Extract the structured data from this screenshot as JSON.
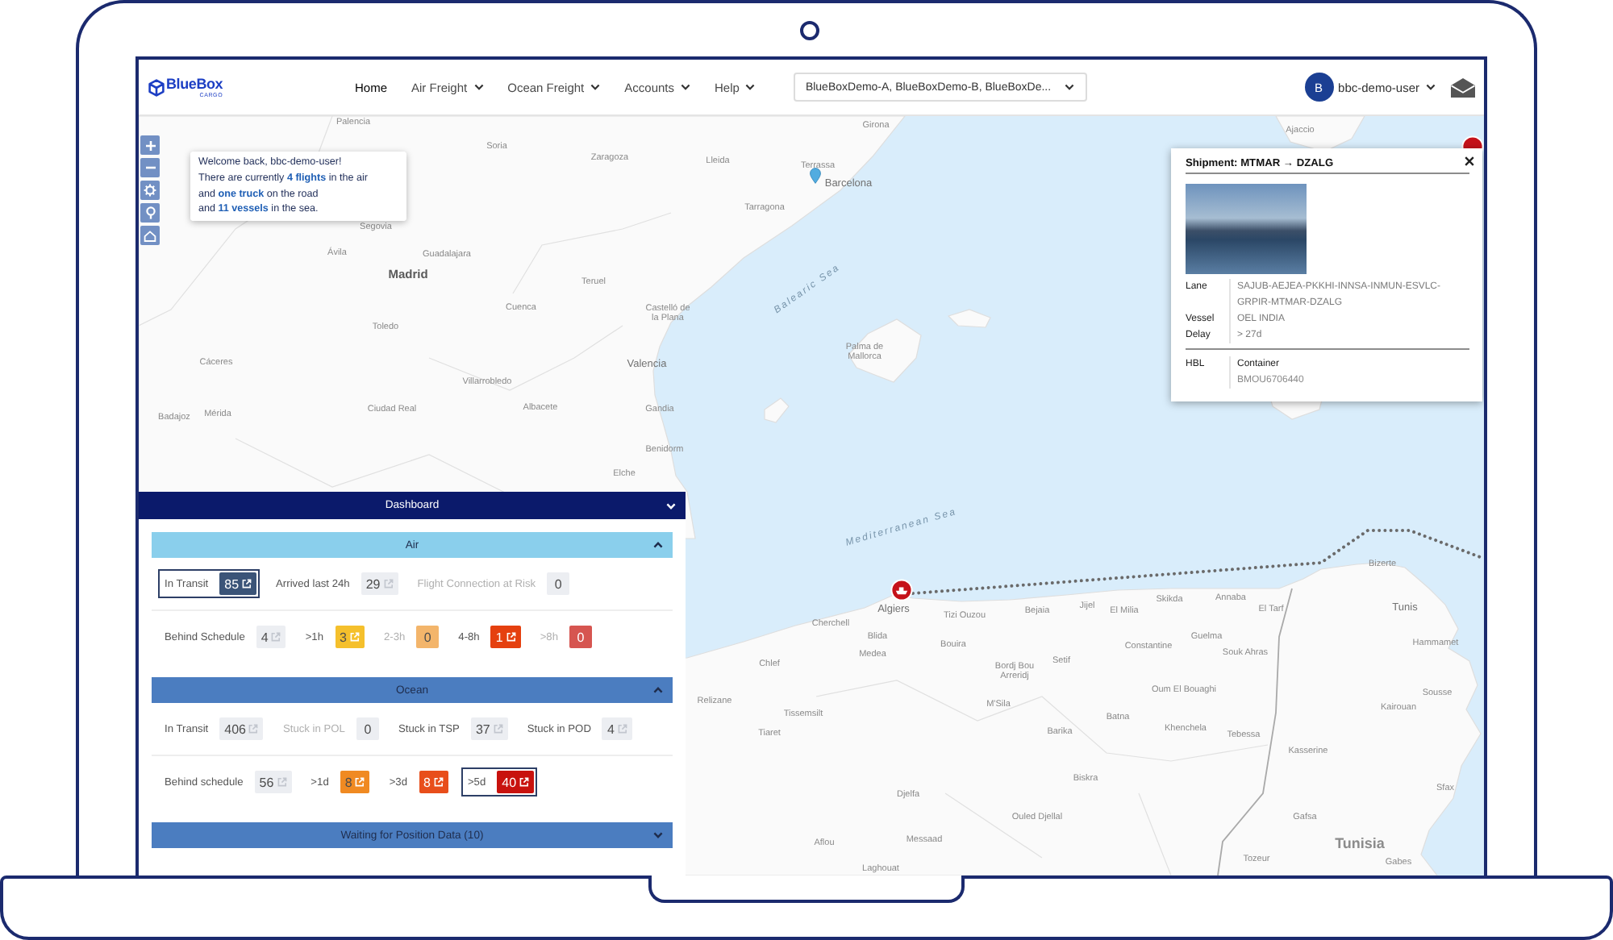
{
  "header": {
    "logo": {
      "name": "BlueBox",
      "tagline": "CARGO"
    },
    "nav": [
      {
        "label": "Home",
        "selected": true,
        "dropdown": false
      },
      {
        "label": "Air Freight",
        "selected": false,
        "dropdown": true
      },
      {
        "label": "Ocean Freight",
        "selected": false,
        "dropdown": true
      },
      {
        "label": "Accounts",
        "selected": false,
        "dropdown": true
      },
      {
        "label": "Help",
        "selected": false,
        "dropdown": true
      }
    ],
    "account_filter": {
      "value": "BlueBoxDemo-A, BlueBoxDemo-B, BlueBoxDe..."
    },
    "user": {
      "initial": "B",
      "name": "bbc-demo-user"
    }
  },
  "map": {
    "labels": [
      {
        "text": "Palencia",
        "kind": "city"
      },
      {
        "text": "Soria",
        "kind": "city"
      },
      {
        "text": "Zaragoza",
        "kind": "city"
      },
      {
        "text": "Segovia",
        "kind": "city"
      },
      {
        "text": "Ávila",
        "kind": "city"
      },
      {
        "text": "Guadalajara",
        "kind": "city"
      },
      {
        "text": "Madrid",
        "kind": "capital"
      },
      {
        "text": "Teruel",
        "kind": "city"
      },
      {
        "text": "Cuenca",
        "kind": "city"
      },
      {
        "text": "Castelló de la Plana",
        "kind": "city"
      },
      {
        "text": "Toledo",
        "kind": "city"
      },
      {
        "text": "Cáceres",
        "kind": "city"
      },
      {
        "text": "Valencia",
        "kind": "major"
      },
      {
        "text": "Villarrobledo",
        "kind": "city"
      },
      {
        "text": "Ciudad Real",
        "kind": "city"
      },
      {
        "text": "Albacete",
        "kind": "city"
      },
      {
        "text": "Gandia",
        "kind": "city"
      },
      {
        "text": "Mérida",
        "kind": "city"
      },
      {
        "text": "Badajoz",
        "kind": "city"
      },
      {
        "text": "Benidorm",
        "kind": "city"
      },
      {
        "text": "Elche",
        "kind": "city"
      },
      {
        "text": "Girona",
        "kind": "city"
      },
      {
        "text": "Lleida",
        "kind": "city"
      },
      {
        "text": "Terrassa",
        "kind": "city"
      },
      {
        "text": "Barcelona",
        "kind": "major"
      },
      {
        "text": "Tarragona",
        "kind": "city"
      },
      {
        "text": "Ajaccio",
        "kind": "city"
      },
      {
        "text": "Balearic Sea",
        "kind": "sea"
      },
      {
        "text": "Palma de Mallorca",
        "kind": "city"
      },
      {
        "text": "Mediterranean Sea",
        "kind": "sea"
      },
      {
        "text": "Algiers",
        "kind": "major"
      },
      {
        "text": "Tizi Ouzou",
        "kind": "city"
      },
      {
        "text": "Bejaia",
        "kind": "city"
      },
      {
        "text": "Jijel",
        "kind": "city"
      },
      {
        "text": "El Milia",
        "kind": "city"
      },
      {
        "text": "Skikda",
        "kind": "city"
      },
      {
        "text": "Annaba",
        "kind": "city"
      },
      {
        "text": "El Tarf",
        "kind": "city"
      },
      {
        "text": "Bizerte",
        "kind": "city"
      },
      {
        "text": "Tunis",
        "kind": "major"
      },
      {
        "text": "Cherchell",
        "kind": "city"
      },
      {
        "text": "Blida",
        "kind": "city"
      },
      {
        "text": "Medea",
        "kind": "city"
      },
      {
        "text": "Bouira",
        "kind": "city"
      },
      {
        "text": "Chlef",
        "kind": "city"
      },
      {
        "text": "Relizane",
        "kind": "city"
      },
      {
        "text": "Tissemsilt",
        "kind": "city"
      },
      {
        "text": "Tiaret",
        "kind": "city"
      },
      {
        "text": "Bordj Bou Arreridj",
        "kind": "city"
      },
      {
        "text": "Setif",
        "kind": "city"
      },
      {
        "text": "Constantine",
        "kind": "city"
      },
      {
        "text": "Guelma",
        "kind": "city"
      },
      {
        "text": "Souk Ahras",
        "kind": "city"
      },
      {
        "text": "Hammamet",
        "kind": "city"
      },
      {
        "text": "M'Sila",
        "kind": "city"
      },
      {
        "text": "Oum El Bouaghi",
        "kind": "city"
      },
      {
        "text": "Batna",
        "kind": "city"
      },
      {
        "text": "Barika",
        "kind": "city"
      },
      {
        "text": "Khenchela",
        "kind": "city"
      },
      {
        "text": "Tebessa",
        "kind": "city"
      },
      {
        "text": "Sousse",
        "kind": "city"
      },
      {
        "text": "Kairouan",
        "kind": "city"
      },
      {
        "text": "Kasserine",
        "kind": "city"
      },
      {
        "text": "Biskra",
        "kind": "city"
      },
      {
        "text": "Djelfa",
        "kind": "city"
      },
      {
        "text": "Sfax",
        "kind": "city"
      },
      {
        "text": "Gafsa",
        "kind": "city"
      },
      {
        "text": "Ouled Djellal",
        "kind": "city"
      },
      {
        "text": "Aflou",
        "kind": "city"
      },
      {
        "text": "Messaad",
        "kind": "city"
      },
      {
        "text": "Tunisia",
        "kind": "country"
      },
      {
        "text": "Tozeur",
        "kind": "city"
      },
      {
        "text": "Gabes",
        "kind": "city"
      },
      {
        "text": "Laghouat",
        "kind": "city"
      }
    ]
  },
  "welcome": {
    "greeting": "Welcome back, bbc-demo-user!",
    "message": "There are currently **4 flights** in the air\nand **one truck** on the road\nand **11 vessels** in the sea."
  },
  "popup": {
    "title": "Shipment: MTMAR → DZALG",
    "details": [
      {
        "label": "Lane",
        "value": "SAJUB-AEJEA-PKKHI-INNSA-INMUN-ESVLC-GRPIR-MTMAR-DZALG"
      },
      {
        "label": "Vessel",
        "value": "OEL INDIA"
      },
      {
        "label": "Delay",
        "value": "> 27d"
      }
    ],
    "reference": {
      "label": "HBL",
      "heading": "Container",
      "value": "BMOU6706440"
    }
  },
  "dashboard": {
    "title": "Dashboard",
    "sections": [
      {
        "title": "Air",
        "color": "#8acfec",
        "expanded": true,
        "rows": [
          [
            {
              "label": "In Transit",
              "value": "85",
              "color": "#3b5478",
              "selected": true,
              "disabled": false
            },
            {
              "label": "Arrived last 24h",
              "value": "29",
              "color": "#eceef2",
              "selected": false,
              "disabled": false
            },
            {
              "label": "Flight Connection at Risk",
              "value": "0",
              "color": "#eceef2",
              "selected": false,
              "disabled": true
            }
          ],
          [
            {
              "label": "Behind Schedule",
              "value": "4",
              "color": "#eceef2",
              "selected": false,
              "disabled": false
            },
            {
              "label": ">1h",
              "value": "3",
              "color": "#f5c02c",
              "selected": false,
              "disabled": false
            },
            {
              "label": "2-3h",
              "value": "0",
              "color": "#f3b56b",
              "selected": false,
              "disabled": true
            },
            {
              "label": "4-8h",
              "value": "1",
              "color": "#e5400f",
              "selected": false,
              "disabled": false
            },
            {
              "label": ">8h",
              "value": "0",
              "color": "#d65550",
              "selected": false,
              "disabled": true
            }
          ]
        ]
      },
      {
        "title": "Ocean",
        "color": "#4b7dc0",
        "expanded": true,
        "rows": [
          [
            {
              "label": "In Transit",
              "value": "406",
              "color": "#eceef2",
              "selected": false,
              "disabled": false
            },
            {
              "label": "Stuck in POL",
              "value": "0",
              "color": "#eceef2",
              "selected": false,
              "disabled": true
            },
            {
              "label": "Stuck in TSP",
              "value": "37",
              "color": "#eceef2",
              "selected": false,
              "disabled": false
            },
            {
              "label": "Stuck in POD",
              "value": "4",
              "color": "#eceef2",
              "selected": false,
              "disabled": false
            }
          ],
          [
            {
              "label": "Behind schedule",
              "value": "56",
              "color": "#eceef2",
              "selected": false,
              "disabled": false
            },
            {
              "label": ">1d",
              "value": "8",
              "color": "#f08a22",
              "selected": false,
              "disabled": false
            },
            {
              "label": ">3d",
              "value": "8",
              "color": "#e84e1b",
              "selected": false,
              "disabled": false
            },
            {
              "label": ">5d",
              "value": "40",
              "color": "#c8120e",
              "selected": true,
              "disabled": false
            }
          ]
        ]
      },
      {
        "title": "Waiting for Position Data (10)",
        "color": "#4b7dc0",
        "expanded": false
      }
    ]
  }
}
